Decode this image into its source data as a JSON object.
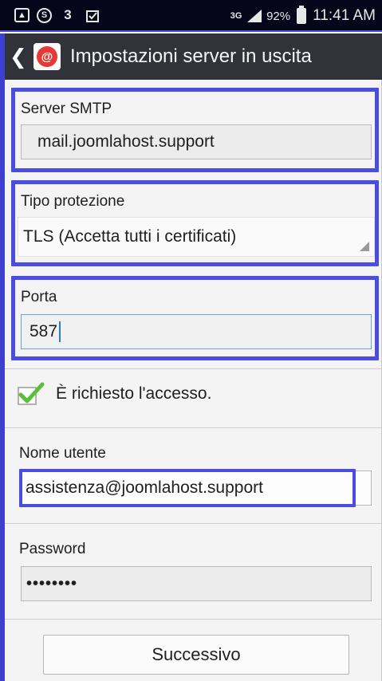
{
  "status_bar": {
    "left_icons": [
      "image-icon",
      "s-icon",
      "three-icon",
      "clipboard-icon"
    ],
    "network_type": "3G",
    "battery_percent": "92%",
    "time": "11:41 AM"
  },
  "action_bar": {
    "back_icon": "chevron-left-icon",
    "app_icon": "email-at-icon",
    "title": "Impostazioni server in uscita"
  },
  "form": {
    "smtp_server": {
      "label": "Server SMTP",
      "value": "mail.joomlahost.support"
    },
    "security_type": {
      "label": "Tipo protezione",
      "selected": "TLS (Accetta tutti i certificati)"
    },
    "port": {
      "label": "Porta",
      "value": "587"
    },
    "login_required": {
      "label": "È richiesto l'accesso.",
      "checked": true
    },
    "username": {
      "label": "Nome utente",
      "value": "assistenza@joomlahost.support"
    },
    "password": {
      "label": "Password",
      "value": "••••••••"
    }
  },
  "buttons": {
    "next": "Successivo"
  },
  "colors": {
    "highlight": "#4b4de0",
    "action_bar": "#32333a",
    "checkmark": "#5cbf3a",
    "app_icon_red": "#e53935"
  }
}
